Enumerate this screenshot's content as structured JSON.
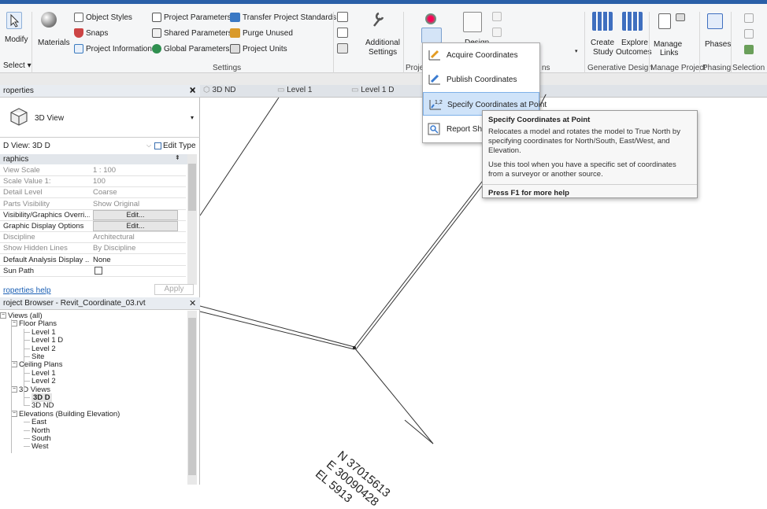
{
  "ribbon": {
    "modify": "Modify",
    "materials": "Materials",
    "object_styles": "Object Styles",
    "snaps": "Snaps",
    "project_information": "Project Information",
    "project_parameters": "Project Parameters",
    "shared_parameters": "Shared Parameters",
    "global_parameters": "Global Parameters",
    "transfer_project_standards": "Transfer Project Standards",
    "purge_unused": "Purge Unused",
    "project_units": "Project Units",
    "additional_settings_1": "Additional",
    "additional_settings_2": "Settings",
    "select": "Select ▾",
    "settings_group": "Settings",
    "project_group_partial": "Proje",
    "design_partial": "Design",
    "locations_partial": "ns",
    "create_study": "Create\nStudy",
    "create": "Create",
    "study": "Study",
    "explore": "Explore",
    "outcomes": "Outcomes",
    "manage": "Manage",
    "links": "Links",
    "phases": "Phases",
    "generative_design": "Generative Design",
    "manage_project": "Manage Project",
    "phasing": "Phasing",
    "selection": "Selection"
  },
  "properties": {
    "title": "roperties",
    "type_name": "3D View",
    "view_selector": "D View: 3D D",
    "edit_type": "Edit Type",
    "section": "raphics",
    "rows": [
      {
        "k": "View Scale",
        "v": "1 : 100",
        "dis": true
      },
      {
        "k": "Scale Value    1:",
        "v": "100",
        "dis": true
      },
      {
        "k": "Detail Level",
        "v": "Coarse",
        "dis": true
      },
      {
        "k": "Parts Visibility",
        "v": "Show Original",
        "dis": true
      },
      {
        "k": "Visibility/Graphics Overri...",
        "v": "Edit...",
        "btn": true
      },
      {
        "k": "Graphic Display Options",
        "v": "Edit...",
        "btn": true
      },
      {
        "k": "Discipline",
        "v": "Architectural",
        "dis": true
      },
      {
        "k": "Show Hidden Lines",
        "v": "By Discipline",
        "dis": true
      },
      {
        "k": "Default Analysis Display ...",
        "v": "None"
      },
      {
        "k": "Sun Path",
        "v": ""
      }
    ],
    "help_link": "roperties help",
    "apply": "Apply"
  },
  "browser": {
    "title": "roject Browser - Revit_Coordinate_03.rvt",
    "views_all": "Views (all)",
    "floor_plans": "Floor Plans",
    "fp_items": [
      "Level 1",
      "Level 1 D",
      "Level 2",
      "Site"
    ],
    "ceiling_plans": "Ceiling Plans",
    "cp_items": [
      "Level 1",
      "Level 2"
    ],
    "views_3d": "3D Views",
    "v3d_items": [
      "3D D",
      "3D ND"
    ],
    "elevations": "Elevations (Building Elevation)",
    "el_items": [
      "East",
      "North",
      "South",
      "West"
    ]
  },
  "tabs": [
    "3D ND",
    "Level 1",
    "Level 1 D"
  ],
  "dropdown": {
    "items": [
      "Acquire Coordinates",
      "Publish Coordinates",
      "Specify Coordinates at Point",
      "Report Shar"
    ]
  },
  "tooltip": {
    "title": "Specify Coordinates at Point",
    "p1": "Relocates a model and rotates the model to True North by specifying coordinates for North/South, East/West, and Elevation.",
    "p2": "Use this tool when you have a specific set of coordinates from a surveyor or another source.",
    "help": "Press F1 for more help"
  },
  "canvas": {
    "n": "N 37015613",
    "e": "E 30090428",
    "el": "EL 5913"
  }
}
